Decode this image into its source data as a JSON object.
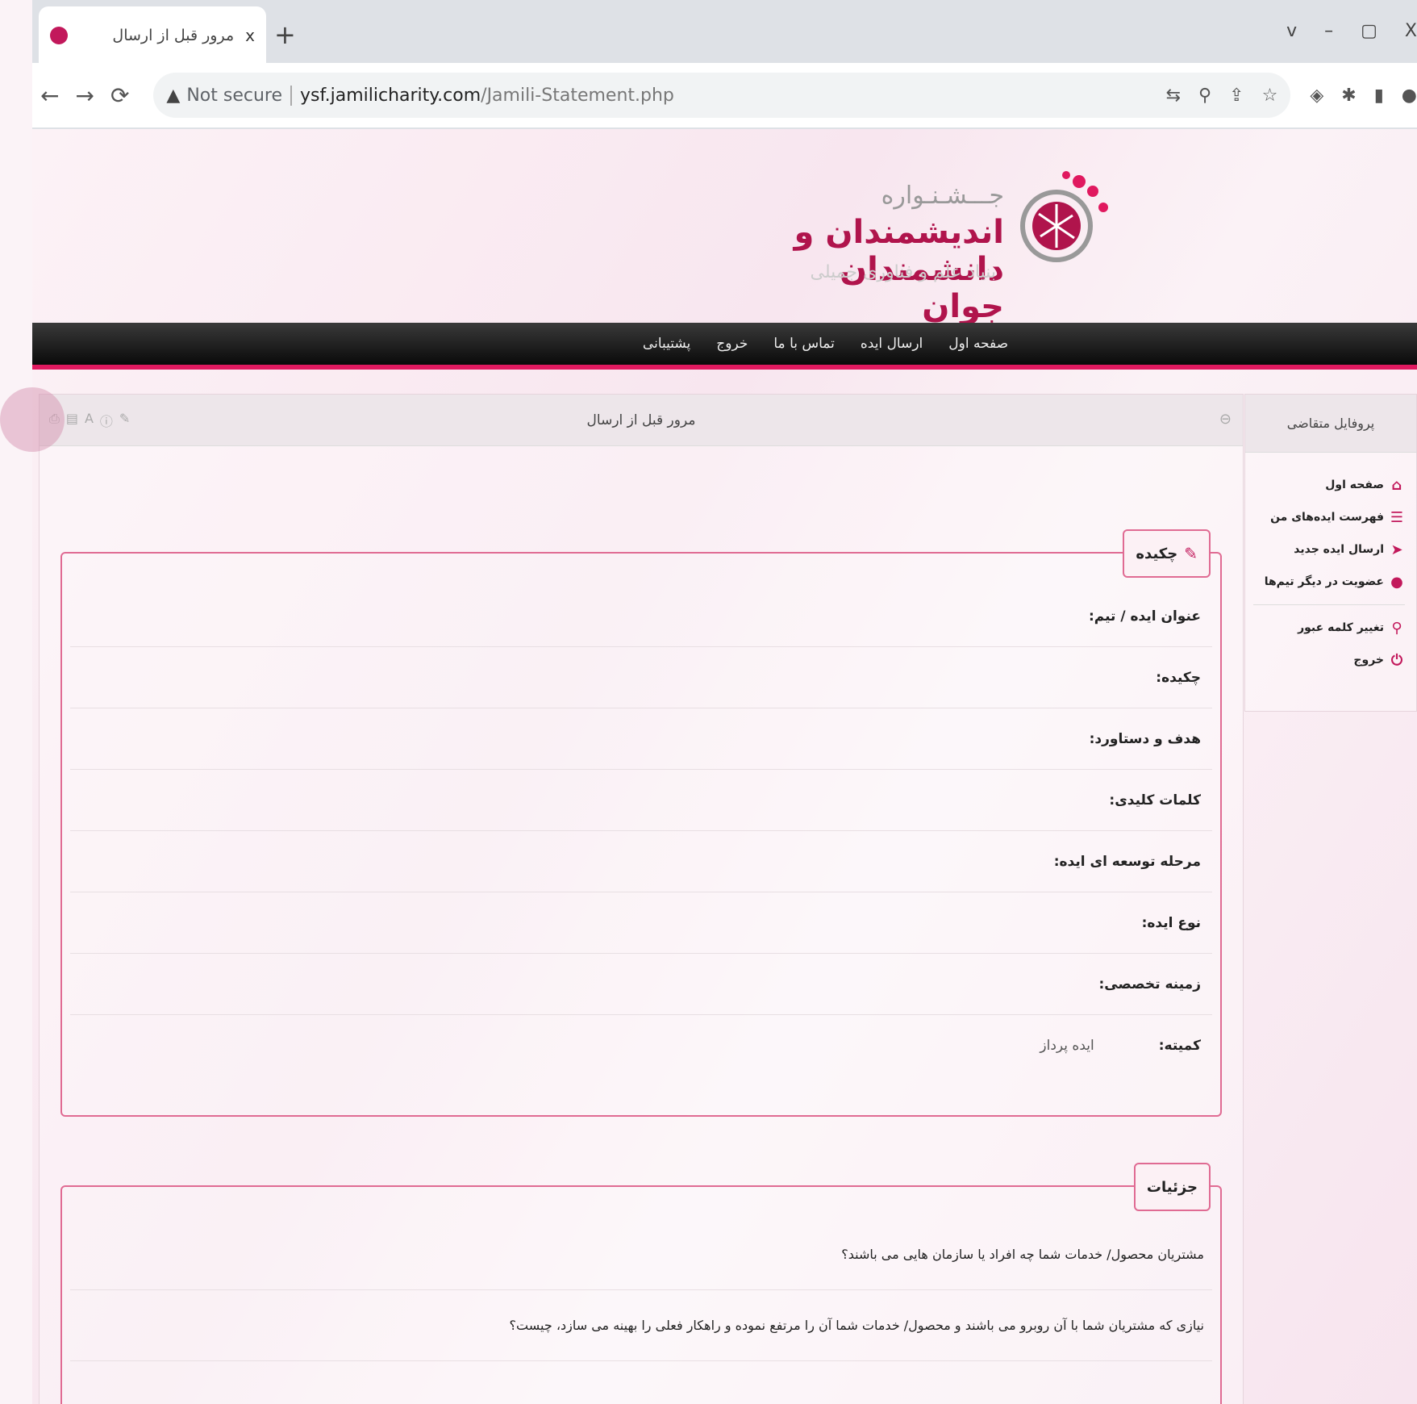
{
  "browser": {
    "tab_title": "مرور قبل از ارسال",
    "tab_close": "x",
    "new_tab": "+",
    "window_controls": [
      "v",
      "–",
      "▢",
      "X"
    ],
    "url_warning": "Not secure",
    "url_host": "ysf.jamilicharity.com",
    "url_path": "/Jamili-Statement.php"
  },
  "header": {
    "logo_line1": "جـــشـنـواره",
    "logo_line2": "اندیشمندان و دانشمندان جوان",
    "logo_line3": "بنیاد علم و فناوری جمیلی"
  },
  "menu": {
    "items": [
      "صفحه اول",
      "ارسال ایده",
      "تماس با ما",
      "خروج",
      "پشتیبانی"
    ]
  },
  "main": {
    "title": "مرور قبل از ارسال",
    "abstract": {
      "legend": "چکیده",
      "rows": [
        {
          "label": "عنوان ایده / تیم:",
          "value": ""
        },
        {
          "label": "چکیده:",
          "value": ""
        },
        {
          "label": "هدف و دستاورد:",
          "value": ""
        },
        {
          "label": "کلمات کلیدی:",
          "value": ""
        },
        {
          "label": "مرحله توسعه ای ایده:",
          "value": ""
        },
        {
          "label": "نوع ایده:",
          "value": ""
        },
        {
          "label": "زمینه تخصصی:",
          "value": ""
        },
        {
          "label": "کمیته:",
          "value": "ایده پرداز"
        }
      ]
    },
    "details": {
      "legend": "جزئیات",
      "rows": [
        "مشتریان محصول/ خدمات شما چه افراد یا سازمان هایی می باشند؟",
        "نیازی که مشتریان شما با آن روبرو می باشند و محصول/ خدمات شما آن را مرتفع نموده و راهکار فعلی را بهینه می سازد، چیست؟"
      ]
    }
  },
  "sidebar": {
    "title": "پروفایل متقاضی",
    "items": [
      {
        "label": "صفحه اول",
        "icon": "home-icon"
      },
      {
        "label": "فهرست ایده‌های من",
        "icon": "list-icon"
      },
      {
        "label": "ارسال ایده جدید",
        "icon": "send-icon"
      },
      {
        "label": "عضویت در دیگر تیم‌ها",
        "icon": "user-icon"
      }
    ],
    "items2": [
      {
        "label": "تغییر کلمه عبور",
        "icon": "key-icon"
      },
      {
        "label": "خروج",
        "icon": "power-icon"
      }
    ]
  },
  "colors": {
    "accent": "#e0195f",
    "brand": "#b0144c"
  }
}
